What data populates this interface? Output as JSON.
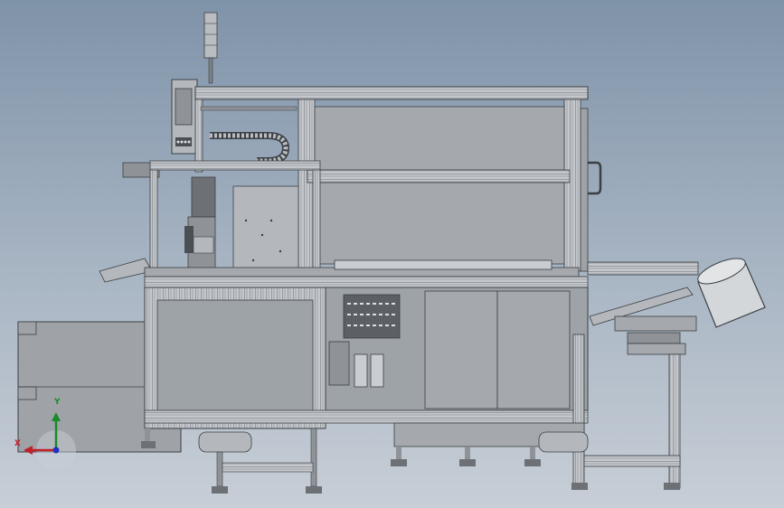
{
  "viewport": {
    "background_top": "#7f93a9",
    "background_bottom": "#c7ced6"
  },
  "axes": {
    "x_label": "X",
    "y_label": "Y",
    "x_color": "#c0202a",
    "y_color": "#1a8a2a",
    "z_color": "#2030c0"
  },
  "colors": {
    "frame": "#b8bcc0",
    "frame_dark": "#5a5e63",
    "panel": "#9ea3a8",
    "panel_light": "#c9cdd1",
    "bowl": "#d4d7da"
  }
}
